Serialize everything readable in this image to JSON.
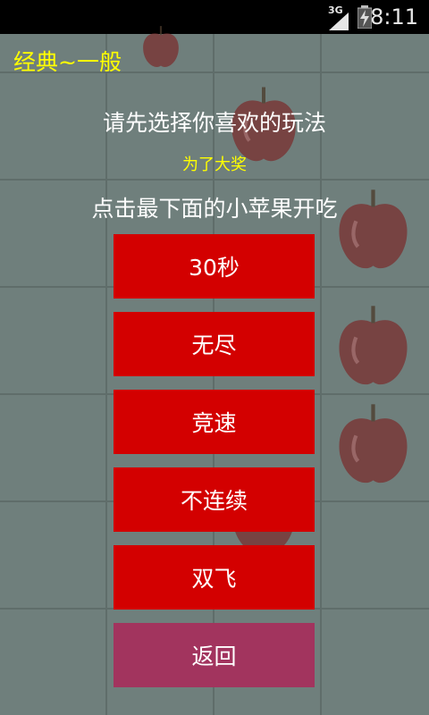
{
  "status_bar": {
    "network": "3G",
    "time": "8:11"
  },
  "header": {
    "mode_title": "经典~一般"
  },
  "prompts": {
    "line1": "请先选择你喜欢的玩法",
    "line2": "为了大奖",
    "line3": "点击最下面的小苹果开吃"
  },
  "buttons": {
    "thirty_seconds": "30秒",
    "endless": "无尽",
    "race": "竞速",
    "discontinuous": "不连续",
    "double_fly": "双飞",
    "back": "返回"
  },
  "colors": {
    "title_yellow": "#ffff00",
    "button_red": "#d30000",
    "back_button": "#a2345e",
    "background": "#6f7f7c"
  }
}
